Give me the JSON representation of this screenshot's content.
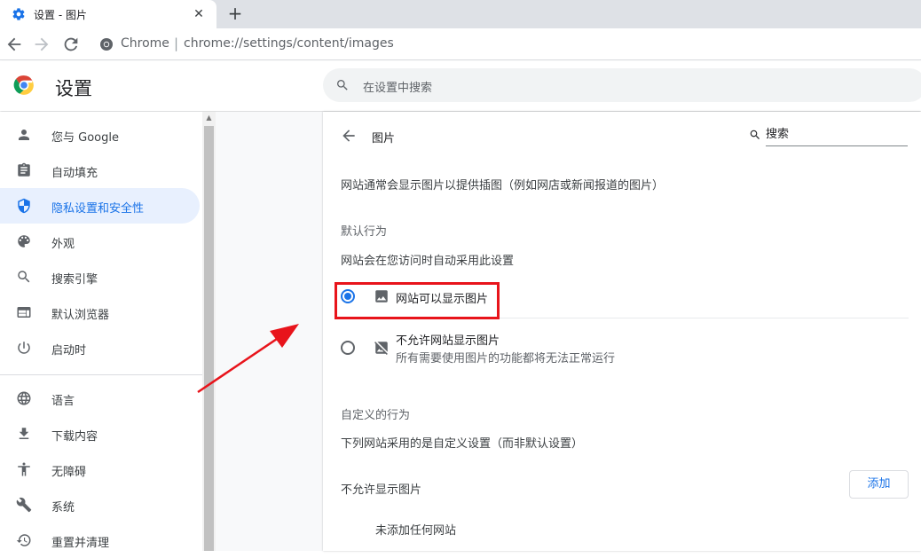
{
  "browser": {
    "tab_title": "设置 - 图片",
    "tab_close": "✕",
    "new_tab": "+",
    "omnibox_label": "Chrome",
    "omnibox_separator": "|",
    "url": "chrome://settings/content/images"
  },
  "header": {
    "title": "设置",
    "search_placeholder": "在设置中搜索"
  },
  "sidebar": {
    "items": [
      {
        "label": "您与 Google",
        "icon": "person-icon",
        "active": false
      },
      {
        "label": "自动填充",
        "icon": "clipboard-icon",
        "active": false
      },
      {
        "label": "隐私设置和安全性",
        "icon": "shield-icon",
        "active": true
      },
      {
        "label": "外观",
        "icon": "palette-icon",
        "active": false
      },
      {
        "label": "搜索引擎",
        "icon": "search-icon",
        "active": false
      },
      {
        "label": "默认浏览器",
        "icon": "browser-icon",
        "active": false
      },
      {
        "label": "启动时",
        "icon": "power-icon",
        "active": false
      },
      {
        "label": "语言",
        "icon": "globe-icon",
        "active": false
      },
      {
        "label": "下载内容",
        "icon": "download-icon",
        "active": false
      },
      {
        "label": "无障碍",
        "icon": "accessibility-icon",
        "active": false
      },
      {
        "label": "系统",
        "icon": "wrench-icon",
        "active": false
      },
      {
        "label": "重置并清理",
        "icon": "reset-icon",
        "active": false
      }
    ]
  },
  "content": {
    "page_title": "图片",
    "search_placeholder": "搜索",
    "description": "网站通常会显示图片以提供插图（例如网店或新闻报道的图片）",
    "default_behavior_title": "默认行为",
    "default_behavior_desc": "网站会在您访问时自动采用此设置",
    "options": [
      {
        "label": "网站可以显示图片",
        "sublabel": "",
        "selected": true,
        "icon": "image-icon"
      },
      {
        "label": "不允许网站显示图片",
        "sublabel": "所有需要使用图片的功能都将无法正常运行",
        "selected": false,
        "icon": "image-off-icon"
      }
    ],
    "custom_behavior_title": "自定义的行为",
    "custom_behavior_desc": "下列网站采用的是自定义设置（而非默认设置）",
    "block_section_title": "不允许显示图片",
    "add_button": "添加",
    "empty_text": "未添加任何网站"
  },
  "colors": {
    "accent": "#1a73e8",
    "active_nav_bg": "#e8f0fe",
    "annotation_red": "#e8141b"
  }
}
